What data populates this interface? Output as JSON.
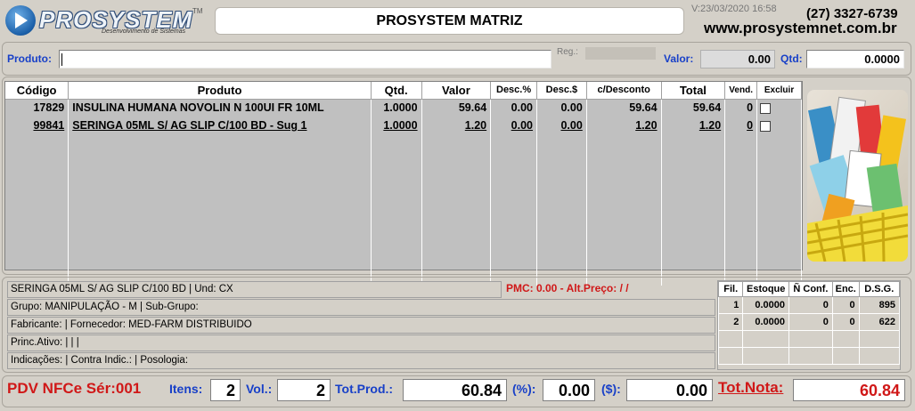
{
  "header": {
    "logo_brand": "PROSYSTEM",
    "logo_tm": "TM",
    "logo_sub": "Desenvolvimento de Sistemas",
    "title": "PROSYSTEM MATRIZ",
    "version": "V:23/03/2020 16:58",
    "phone": "(27) 3327-6739",
    "website": "www.prosystemnet.com.br"
  },
  "product_bar": {
    "produto_label": "Produto:",
    "produto_value": "",
    "reg_label": "Reg.:",
    "valor_label": "Valor:",
    "valor_value": "0.00",
    "qtd_label": "Qtd:",
    "qtd_value": "0.0000"
  },
  "grid": {
    "headers": [
      "Código",
      "Produto",
      "Qtd.",
      "Valor",
      "Desc.%",
      "Desc.$",
      "c/Desconto",
      "Total",
      "Vend.",
      "Excluir"
    ],
    "rows": [
      {
        "codigo": "17829",
        "produto": "INSULINA HUMANA NOVOLIN N 100UI FR 10ML",
        "qtd": "1.0000",
        "valor": "59.64",
        "desc_pct": "0.00",
        "desc_val": "0.00",
        "c_desconto": "59.64",
        "total": "59.64",
        "vend": "0"
      },
      {
        "codigo": "99841",
        "produto": "SERINGA 05ML S/ AG SLIP C/100 BD - Sug 1",
        "qtd": "1.0000",
        "valor": "1.20",
        "desc_pct": "0.00",
        "desc_val": "0.00",
        "c_desconto": "1.20",
        "total": "1.20",
        "vend": "0"
      }
    ]
  },
  "info": {
    "descricao": "SERINGA 05ML S/ AG SLIP C/100 BD | Und: CX",
    "pmc": "PMC:      0.00 - Alt.Preço:  /  /",
    "grupo": "Grupo: MANIPULAÇÃO - M | Sub-Grupo:",
    "fabricante": "Fabricante:  |  Fornecedor: MED-FARM DISTRIBUIDO",
    "princ_ativo": "Princ.Ativo:  |  |  |",
    "indicacoes": "Indicações:  | Contra Indic.:  | Posologia:"
  },
  "stock": {
    "headers": [
      "Fil.",
      "Estoque",
      "Ñ Conf.",
      "Enc.",
      "D.S.G."
    ],
    "rows": [
      [
        "1",
        "0.0000",
        "0",
        "0",
        "895"
      ],
      [
        "2",
        "0.0000",
        "0",
        "0",
        "622"
      ]
    ]
  },
  "footer": {
    "pdv": "PDV NFCe Sér:001",
    "itens_label": "Itens:",
    "itens_value": "2",
    "vol_label": "Vol.:",
    "vol_value": "2",
    "totprod_label": "Tot.Prod.:",
    "totprod_value": "60.84",
    "pct_label": "(%):",
    "pct_value": "0.00",
    "dollar_label": "($):",
    "dollar_value": "0.00",
    "totnota_label": "Tot.Nota:",
    "totnota_value": "60.84"
  },
  "colors": {
    "label_blue": "#1840c8",
    "alert_red": "#d01818",
    "window_bg": "#d4d0c8"
  }
}
